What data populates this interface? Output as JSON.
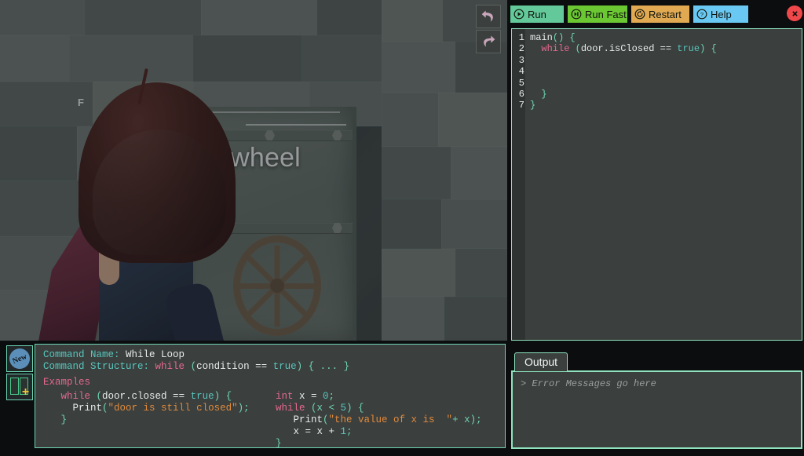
{
  "game": {
    "door_label": "wheel",
    "partial_label": "F",
    "undo_icon": "undo-arrow-icon",
    "redo_icon": "redo-arrow-icon"
  },
  "toolbar": {
    "run_label": "Run",
    "run_fast_label": "Run Fast",
    "restart_label": "Restart",
    "help_label": "Help",
    "close_label": "✕",
    "colors": {
      "run": "#63c99a",
      "run_fast": "#6bc832",
      "restart": "#e0a952",
      "help": "#69c9f3",
      "close": "#f0484a"
    }
  },
  "editor": {
    "line_numbers": "1\n2\n3\n4\n5\n6\n7",
    "lines": [
      {
        "num": "1",
        "text": "main() {"
      },
      {
        "num": "2",
        "text": "  while (door.isClosed == true) {"
      },
      {
        "num": "3",
        "text": ""
      },
      {
        "num": "4",
        "text": ""
      },
      {
        "num": "5",
        "text": ""
      },
      {
        "num": "6",
        "text": "  }"
      },
      {
        "num": "7",
        "text": "}"
      }
    ],
    "tokens": {
      "main": "main",
      "open_paren_brace": "() {",
      "while": "while",
      "cond_open": " (",
      "cond_expr": "door.isClosed == ",
      "true": "true",
      "cond_close": ") {",
      "close_inner": "  }",
      "close_outer": "}"
    }
  },
  "output": {
    "tab_label": "Output",
    "placeholder": "> Error Messages go here"
  },
  "command": {
    "name_label": "Command Name:",
    "name_value": "While Loop",
    "structure_label": "Command Structure:",
    "structure_kw": "while",
    "structure_rest_open": " (",
    "structure_cond": "condition == ",
    "structure_true": "true",
    "structure_rest_close": ") { ... }",
    "examples_title": "Examples",
    "example_left": {
      "l1_kw": "while",
      "l1_a": " (",
      "l1_b": "door.closed == ",
      "l1_true": "true",
      "l1_c": ") {",
      "l2_a": "  Print",
      "l2_b": "(",
      "l2_str": "\"door is still closed\"",
      "l2_c": ");",
      "l3": "}"
    },
    "example_right": {
      "l1_kw": "int",
      "l1_a": " x = ",
      "l1_num": "0",
      "l1_b": ";",
      "l2_kw": "while",
      "l2_a": " (x < ",
      "l2_num": "5",
      "l2_b": ") {",
      "l3_a": "   Print",
      "l3_b": "(",
      "l3_str": "\"the value of x is  \"",
      "l3_c": "+ x);",
      "l4_a": "   x = x + ",
      "l4_num": "1",
      "l4_b": ";",
      "l5": "}"
    },
    "icons": {
      "new_badge": "New",
      "book": "book-plus-icon"
    }
  }
}
